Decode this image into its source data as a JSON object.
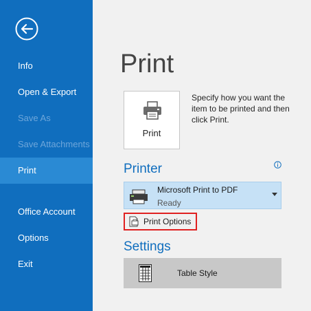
{
  "sidebar": {
    "back_icon": "back-arrow-icon",
    "items": [
      {
        "label": "Info",
        "state": "normal"
      },
      {
        "label": "Open & Export",
        "state": "normal"
      },
      {
        "label": "Save As",
        "state": "disabled"
      },
      {
        "label": "Save Attachments",
        "state": "disabled"
      },
      {
        "label": "Print",
        "state": "selected"
      },
      {
        "label": "Office Account",
        "state": "normal"
      },
      {
        "label": "Options",
        "state": "normal"
      },
      {
        "label": "Exit",
        "state": "normal"
      }
    ],
    "colors": {
      "background": "#106ebe",
      "selected": "#2a8ad4",
      "disabled_text": "#6ea6da"
    }
  },
  "main": {
    "title": "Print",
    "print_button": {
      "label": "Print",
      "icon": "printer-icon"
    },
    "description": "Specify how you want the item to be printed and then click Print.",
    "printer_section": {
      "heading": "Printer",
      "info_icon": "info-icon",
      "selected_printer": {
        "name": "Microsoft Print to PDF",
        "status": "Ready",
        "icon": "printer-device-icon"
      },
      "print_options": {
        "label": "Print Options",
        "icon": "print-options-icon",
        "highlight_color": "#e02020"
      }
    },
    "settings_section": {
      "heading": "Settings",
      "style": {
        "label": "Table Style",
        "icon": "table-style-icon"
      }
    }
  }
}
